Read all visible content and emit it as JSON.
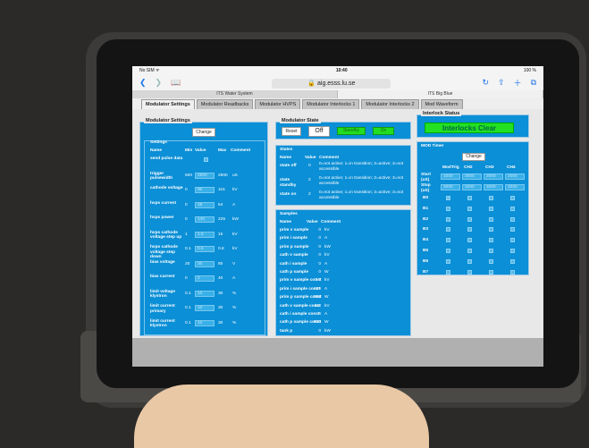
{
  "browser": {
    "status_left": "No SIM ᯤ",
    "time": "10:40",
    "battery": "100 %",
    "url": "🔒 aig.esss.lu.se",
    "tabs": [
      "ITS Water System",
      "ITS Big Blue"
    ]
  },
  "app_tabs": [
    "Modulator Settings",
    "Modulator Readbacks",
    "Modulator HVPS",
    "Modulator Interlocks 1",
    "Modulator Interlocks 2",
    "Mod Waveform"
  ],
  "modulator_settings": {
    "title": "Modulator Settings",
    "change_button": "Change",
    "settings_title": "Settings",
    "headers": {
      "name": "Name",
      "min": "Min",
      "value": "Value",
      "max": "Max",
      "comment": "Comment"
    },
    "rows": [
      {
        "name": "send pulse data",
        "min": "",
        "value": "",
        "max": "",
        "unit": ""
      },
      {
        "name": "trigger pulsewidth",
        "min": "500",
        "value": "2800",
        "max": "2800",
        "unit": "uS"
      },
      {
        "name": "cathode voltage",
        "min": "0",
        "value": "90",
        "max": "115",
        "unit": "kV"
      },
      {
        "name": "hvps current",
        "min": "0",
        "value": "38",
        "max": "54",
        "unit": "A"
      },
      {
        "name": "hvps power",
        "min": "0",
        "value": "140",
        "max": "225",
        "unit": "kW"
      },
      {
        "name": "hvps cathode voltage step up",
        "min": "1",
        "value": "1.5",
        "max": "15",
        "unit": "kV"
      },
      {
        "name": "hvps cathode voltage step down",
        "min": "0.1",
        "value": "0.5",
        "max": "0.8",
        "unit": "kV"
      },
      {
        "name": "bias voltage",
        "min": "20",
        "value": "30",
        "max": "80",
        "unit": "V"
      },
      {
        "name": "bias current",
        "min": "0",
        "value": "2",
        "max": "40",
        "unit": "A"
      },
      {
        "name": "limit voltage klystron",
        "min": "0.1",
        "value": "10",
        "max": "30",
        "unit": "%"
      },
      {
        "name": "limit current primary",
        "min": "0.1",
        "value": "10",
        "max": "30",
        "unit": "%"
      },
      {
        "name": "limit current klystron",
        "min": "0.1",
        "value": "10",
        "max": "30",
        "unit": "%"
      }
    ]
  },
  "modulator_state": {
    "title": "Modulator State",
    "reset": "Reset",
    "off": "Off",
    "standby": "Standby",
    "on": "On"
  },
  "states": {
    "title": "States",
    "headers": {
      "name": "Name",
      "value": "Value",
      "comment": "Comment"
    },
    "rows": [
      {
        "name": "state off",
        "value": "0",
        "comment": "0=not active; 1=in transition; 2=active; 3=not accessible"
      },
      {
        "name": "state standby",
        "value": "2",
        "comment": "0=not active; 1=in transition; 2=active; 3=not accessible"
      },
      {
        "name": "state on",
        "value": "2",
        "comment": "0=not active; 1=in transition; 2=active; 3=not accessible"
      }
    ]
  },
  "samples": {
    "title": "Samples",
    "headers": {
      "name": "Name",
      "value": "Value",
      "comment": "Comment"
    },
    "rows": [
      {
        "name": "prim v sample",
        "value": "0",
        "unit": "kV"
      },
      {
        "name": "prim i sample",
        "value": "0",
        "unit": "A"
      },
      {
        "name": "prim p sample",
        "value": "0",
        "unit": "kW"
      },
      {
        "name": "cath v sample",
        "value": "0",
        "unit": "kV"
      },
      {
        "name": "cath i sample",
        "value": "0",
        "unit": "A"
      },
      {
        "name": "cath p sample",
        "value": "0",
        "unit": "W"
      },
      {
        "name": "prim v sample const",
        "value": "0.7",
        "unit": "kV"
      },
      {
        "name": "prim i sample const",
        "value": "429",
        "unit": "A"
      },
      {
        "name": "prim p sample const",
        "value": "303",
        "unit": "W"
      },
      {
        "name": "cath v sample const",
        "value": "111",
        "unit": "kV"
      },
      {
        "name": "cath i sample const",
        "value": "6",
        "unit": "A"
      },
      {
        "name": "cath p sample const",
        "value": "650",
        "unit": "W"
      },
      {
        "name": "tank p",
        "value": "0",
        "unit": "kW"
      }
    ]
  },
  "interlock": {
    "title": "Interlock Status",
    "status": "Interlocks Clear"
  },
  "mod_timer": {
    "title": "MOD Timer",
    "change": "Change",
    "columns": [
      "ModTrig",
      "CH2",
      "CH3",
      "CH4"
    ],
    "start_label": "Start (uS)",
    "stop_label": "Stop (uS)",
    "start_values": [
      "1000",
      "2000",
      "2000",
      "2000"
    ],
    "stop_values": [
      "3000",
      "3200",
      "3200",
      "3200"
    ],
    "rows": [
      "B0",
      "B1",
      "B2",
      "B3",
      "B4",
      "B5",
      "B6",
      "B7"
    ]
  },
  "colors": {
    "panel": "#0b8fd6",
    "green": "#22dd22"
  }
}
